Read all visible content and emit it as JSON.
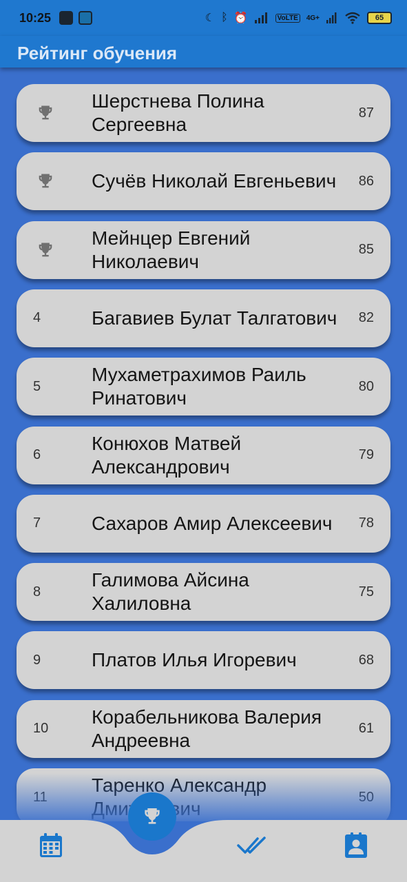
{
  "status_bar": {
    "time": "10:25",
    "network": "4G+",
    "battery": "65"
  },
  "app_bar": {
    "title": "Рейтинг обучения"
  },
  "ranking": [
    {
      "rank": "1",
      "trophy": true,
      "name": "Шерстнева Полина Сергеевна",
      "score": "87"
    },
    {
      "rank": "2",
      "trophy": true,
      "name": "Сучёв Николай Евгеньевич",
      "score": "86"
    },
    {
      "rank": "3",
      "trophy": true,
      "name": "Мейнцер Евгений Николаевич",
      "score": "85"
    },
    {
      "rank": "4",
      "trophy": false,
      "name": "Багавиев Булат Талгатович",
      "score": "82"
    },
    {
      "rank": "5",
      "trophy": false,
      "name": "Мухаметрахимов Раиль Ринатович",
      "score": "80"
    },
    {
      "rank": "6",
      "trophy": false,
      "name": "Конюхов Матвей Александрович",
      "score": "79"
    },
    {
      "rank": "7",
      "trophy": false,
      "name": "Сахаров Амир Алексеевич",
      "score": "78"
    },
    {
      "rank": "8",
      "trophy": false,
      "name": "Галимова Айсина Халиловна",
      "score": "75"
    },
    {
      "rank": "9",
      "trophy": false,
      "name": "Платов Илья Игоревич",
      "score": "68"
    },
    {
      "rank": "10",
      "trophy": false,
      "name": "Корабельникова Валерия Андреевна",
      "score": "61"
    },
    {
      "rank": "11",
      "trophy": false,
      "name": "Таренко Александр Дмитриевич",
      "score": "50"
    }
  ],
  "bottom_nav": {
    "items": [
      {
        "icon": "calendar-icon",
        "active": false
      },
      {
        "icon": "trophy-icon",
        "active": true
      },
      {
        "icon": "double-check-icon",
        "active": false
      },
      {
        "icon": "contact-card-icon",
        "active": false
      }
    ]
  },
  "colors": {
    "background": "#3a6fcc",
    "app_bar": "#1f78cf",
    "card": "#d3d3d3",
    "nav_bar": "#d3d3d3",
    "accent": "#1a77cb"
  }
}
